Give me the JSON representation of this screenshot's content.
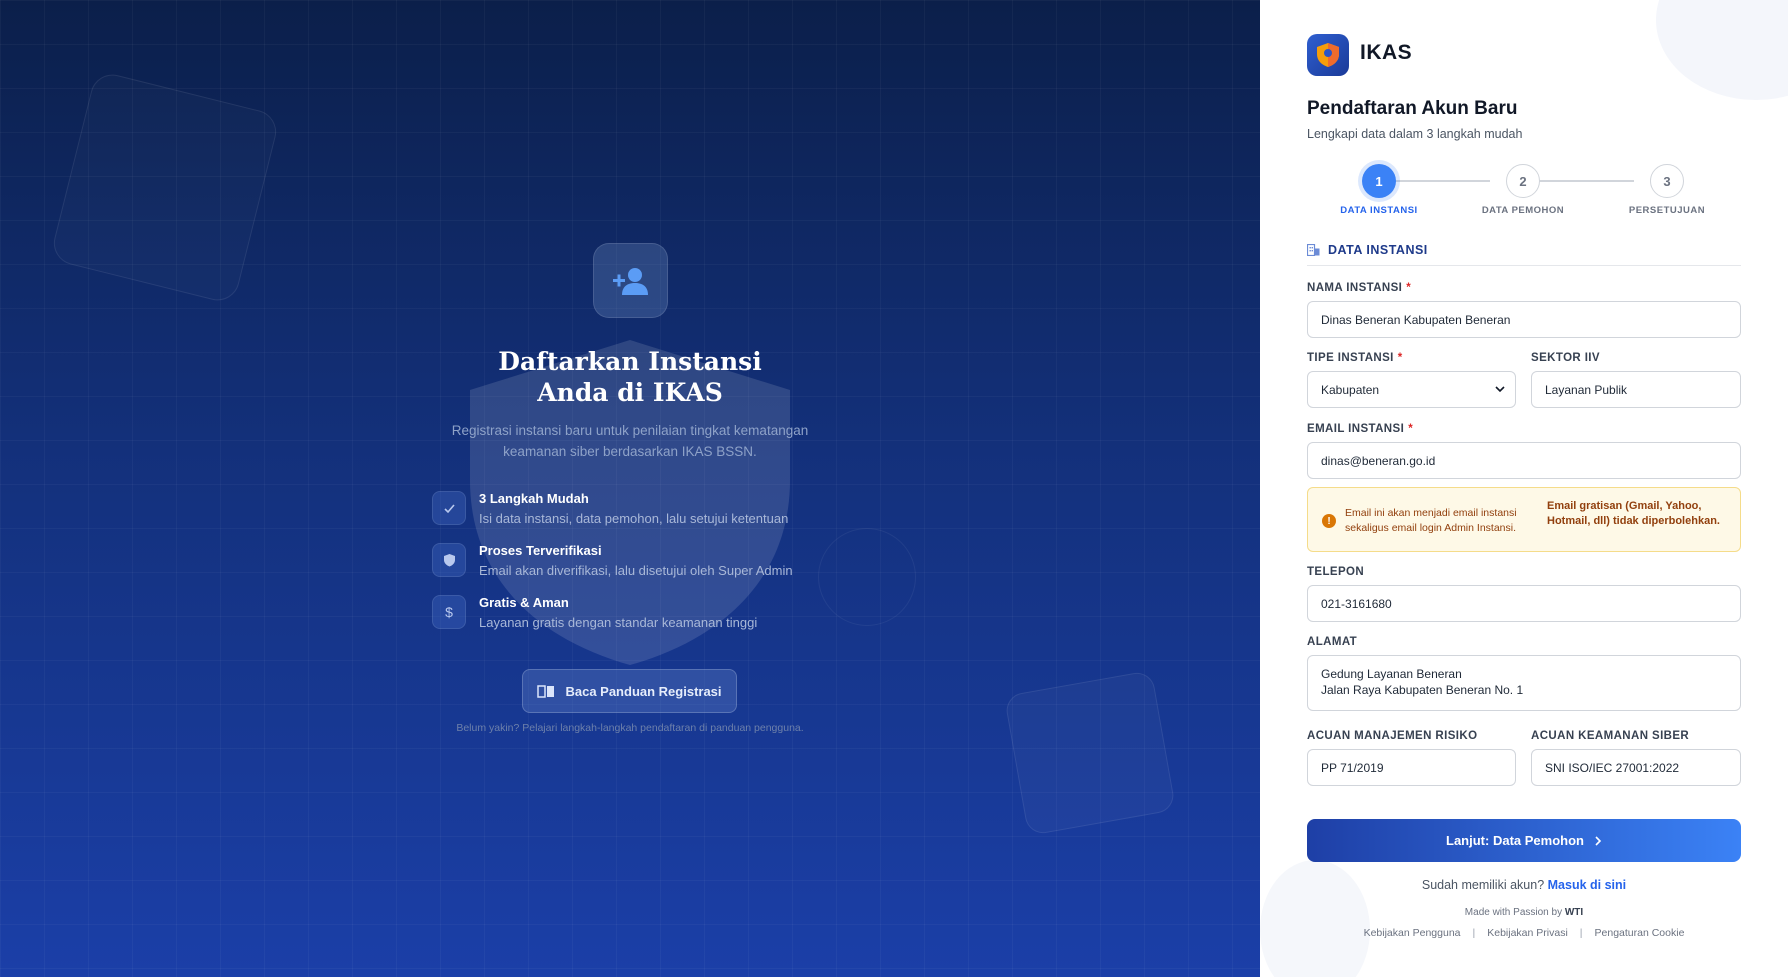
{
  "left": {
    "title_line1": "Daftarkan Instansi",
    "title_line2": "Anda di IKAS",
    "subtitle_line1": "Registrasi instansi baru untuk penilaian tingkat kematangan",
    "subtitle_line2": "keamanan siber berdasarkan IKAS BSSN.",
    "features": [
      {
        "title": "3 Langkah Mudah",
        "desc": "Isi data instansi, data pemohon, lalu setujui ketentuan",
        "icon": "check-icon"
      },
      {
        "title": "Proses Terverifikasi",
        "desc": "Email akan diverifikasi, lalu disetujui oleh Super Admin",
        "icon": "shield-icon"
      },
      {
        "title": "Gratis & Aman",
        "desc": "Layanan gratis dengan standar keamanan tinggi",
        "icon": "dollar-icon"
      }
    ],
    "guide_button": "Baca Panduan Registrasi",
    "guide_note": "Belum yakin? Pelajari langkah-langkah pendaftaran di panduan pengguna."
  },
  "brand": {
    "name": "IKAS"
  },
  "form": {
    "title": "Pendaftaran Akun Baru",
    "subtitle": "Lengkapi data dalam 3 langkah mudah",
    "steps": [
      {
        "number": "1",
        "label": "DATA INSTANSI",
        "active": true
      },
      {
        "number": "2",
        "label": "DATA PEMOHON",
        "active": false
      },
      {
        "number": "3",
        "label": "PERSETUJUAN",
        "active": false
      }
    ],
    "section_title": "DATA INSTANSI",
    "fields": {
      "nama_instansi": {
        "label": "NAMA INSTANSI",
        "value": "Dinas Beneran Kabupaten Beneran"
      },
      "tipe_instansi": {
        "label": "TIPE INSTANSI",
        "value": "Kabupaten"
      },
      "sektor_iiv": {
        "label": "SEKTOR IIV",
        "value": "Layanan Publik"
      },
      "email_instansi": {
        "label": "EMAIL INSTANSI",
        "value": "dinas@beneran.go.id"
      },
      "telepon": {
        "label": "TELEPON",
        "value": "021-3161680"
      },
      "alamat": {
        "label": "ALAMAT",
        "value_line1": "Gedung Layanan Beneran",
        "value_line2": "Jalan Raya Kabupaten Beneran No. 1"
      },
      "acuan_manajemen_risiko": {
        "label": "ACUAN MANAJEMEN RISIKO",
        "value": "PP 71/2019"
      },
      "acuan_keamanan_siber": {
        "label": "ACUAN KEAMANAN SIBER",
        "value": "SNI ISO/IEC 27001:2022"
      }
    },
    "required_mark": "*",
    "warning": {
      "text": "Email ini akan menjadi email instansi sekaligus email login Admin Instansi.",
      "strong": "Email gratisan (Gmail, Yahoo, Hotmail, dll) tidak diperbolehkan."
    },
    "submit_button": "Lanjut: Data Pemohon",
    "login_prompt": "Sudah memiliki akun?",
    "login_link": "Masuk di sini",
    "made_with": "Made with Passion by",
    "made_by": "WTI",
    "footer_links": [
      "Kebijakan Pengguna",
      "Kebijakan Privasi",
      "Pengaturan Cookie"
    ],
    "footer_separator": "|"
  },
  "colors": {
    "primary": "#3b82f6",
    "navy": "#1e3a8a",
    "warning_bg": "#fef9e7",
    "warning_text": "#92400e",
    "required": "#dc2626"
  }
}
